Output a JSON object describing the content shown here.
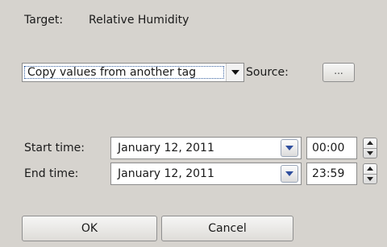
{
  "target": {
    "label": "Target:",
    "value": "Relative Humidity"
  },
  "copy": {
    "mode_value": "Copy values from another tag",
    "source_label": "Source:",
    "browse_label": "..."
  },
  "start": {
    "label": "Start time:",
    "date": "January 12, 2011",
    "time": "00:00"
  },
  "end": {
    "label": "End time:",
    "date": "January 12, 2011",
    "time": "23:59"
  },
  "buttons": {
    "ok": "OK",
    "cancel": "Cancel"
  },
  "icons": {
    "dropdown": "triangle-down-icon",
    "spin_up": "triangle-up-icon",
    "spin_down": "triangle-down-icon"
  },
  "colors": {
    "background": "#d6d3ce",
    "accent": "#2f4f9e"
  }
}
